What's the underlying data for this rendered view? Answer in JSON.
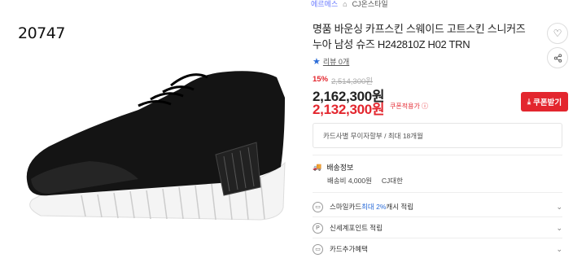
{
  "product_code": "20747",
  "breadcrumb": {
    "prev": "에르메스",
    "brand": "CJ온스타일"
  },
  "title": "명품 바운싱 카프스킨 스웨이드 고트스킨 스니커즈 누아 남성 슈즈 H242810Z H02 TRN",
  "review": {
    "label": "리뷰 0개"
  },
  "pricing": {
    "discount": "15%",
    "original": "2,514,300원",
    "price": "2,162,300원",
    "coupon_price": "2,132,300원",
    "coupon_tag": "쿠폰적용가 ⓘ",
    "coupon_button": "쿠폰받기"
  },
  "installment": "카드사별 무이자할부 / 최대 18개월",
  "shipping": {
    "title": "배송정보",
    "fee": "배송비 4,000원",
    "carrier": "CJ대한"
  },
  "options": [
    {
      "prefix": "스마일카드 ",
      "highlight": "최대 2%",
      "suffix": " 캐시 적립"
    },
    {
      "prefix": "신세계포인트 적립",
      "highlight": "",
      "suffix": ""
    },
    {
      "prefix": "카드추가혜택",
      "highlight": "",
      "suffix": ""
    }
  ],
  "colors": {
    "accent_red": "#e3262e",
    "link_blue": "#2b6cd8"
  }
}
